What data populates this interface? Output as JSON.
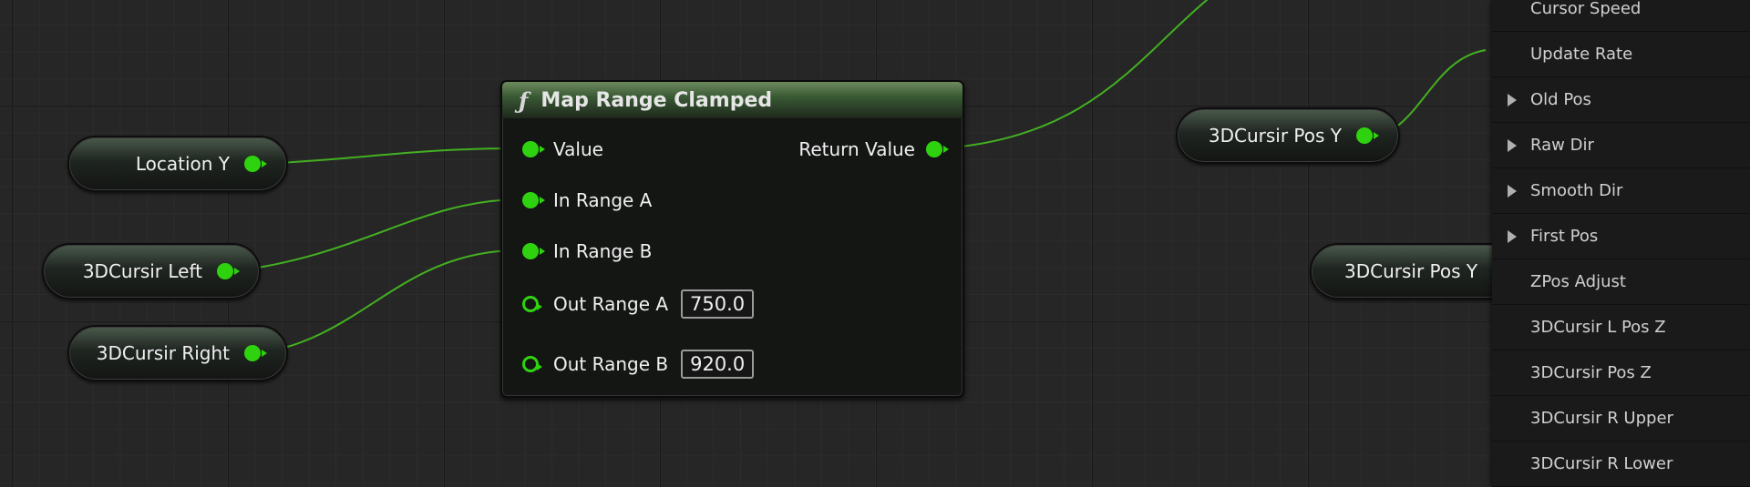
{
  "graph": {
    "colors": {
      "wire": "#43b021",
      "pin": "#2fd20f"
    },
    "variables": {
      "location_y": "Location Y",
      "cursir_left": "3DCursir Left",
      "cursir_right": "3DCursir Right",
      "pos_y_getter": "3DCursir Pos Y",
      "pos_y_partial": "3DCursir Pos Y"
    },
    "function_node": {
      "icon": "function-icon",
      "title": "Map Range Clamped",
      "inputs": {
        "value": "Value",
        "in_range_a": "In Range A",
        "in_range_b": "In Range B",
        "out_range_a": "Out Range A",
        "out_range_b": "Out Range B"
      },
      "defaults": {
        "out_range_a": "750.0",
        "out_range_b": "920.0"
      },
      "output": "Return Value"
    }
  },
  "variables_panel": {
    "items": [
      {
        "label": "Cursor Speed",
        "expandable": false
      },
      {
        "label": "Update Rate",
        "expandable": false
      },
      {
        "label": "Old Pos",
        "expandable": true
      },
      {
        "label": "Raw Dir",
        "expandable": true
      },
      {
        "label": "Smooth Dir",
        "expandable": true
      },
      {
        "label": "First Pos",
        "expandable": true
      },
      {
        "label": "ZPos Adjust",
        "expandable": false
      },
      {
        "label": "3DCursir L Pos Z",
        "expandable": false
      },
      {
        "label": "3DCursir Pos Z",
        "expandable": false
      },
      {
        "label": "3DCursir R Upper",
        "expandable": false
      },
      {
        "label": "3DCursir R Lower",
        "expandable": false
      }
    ]
  }
}
